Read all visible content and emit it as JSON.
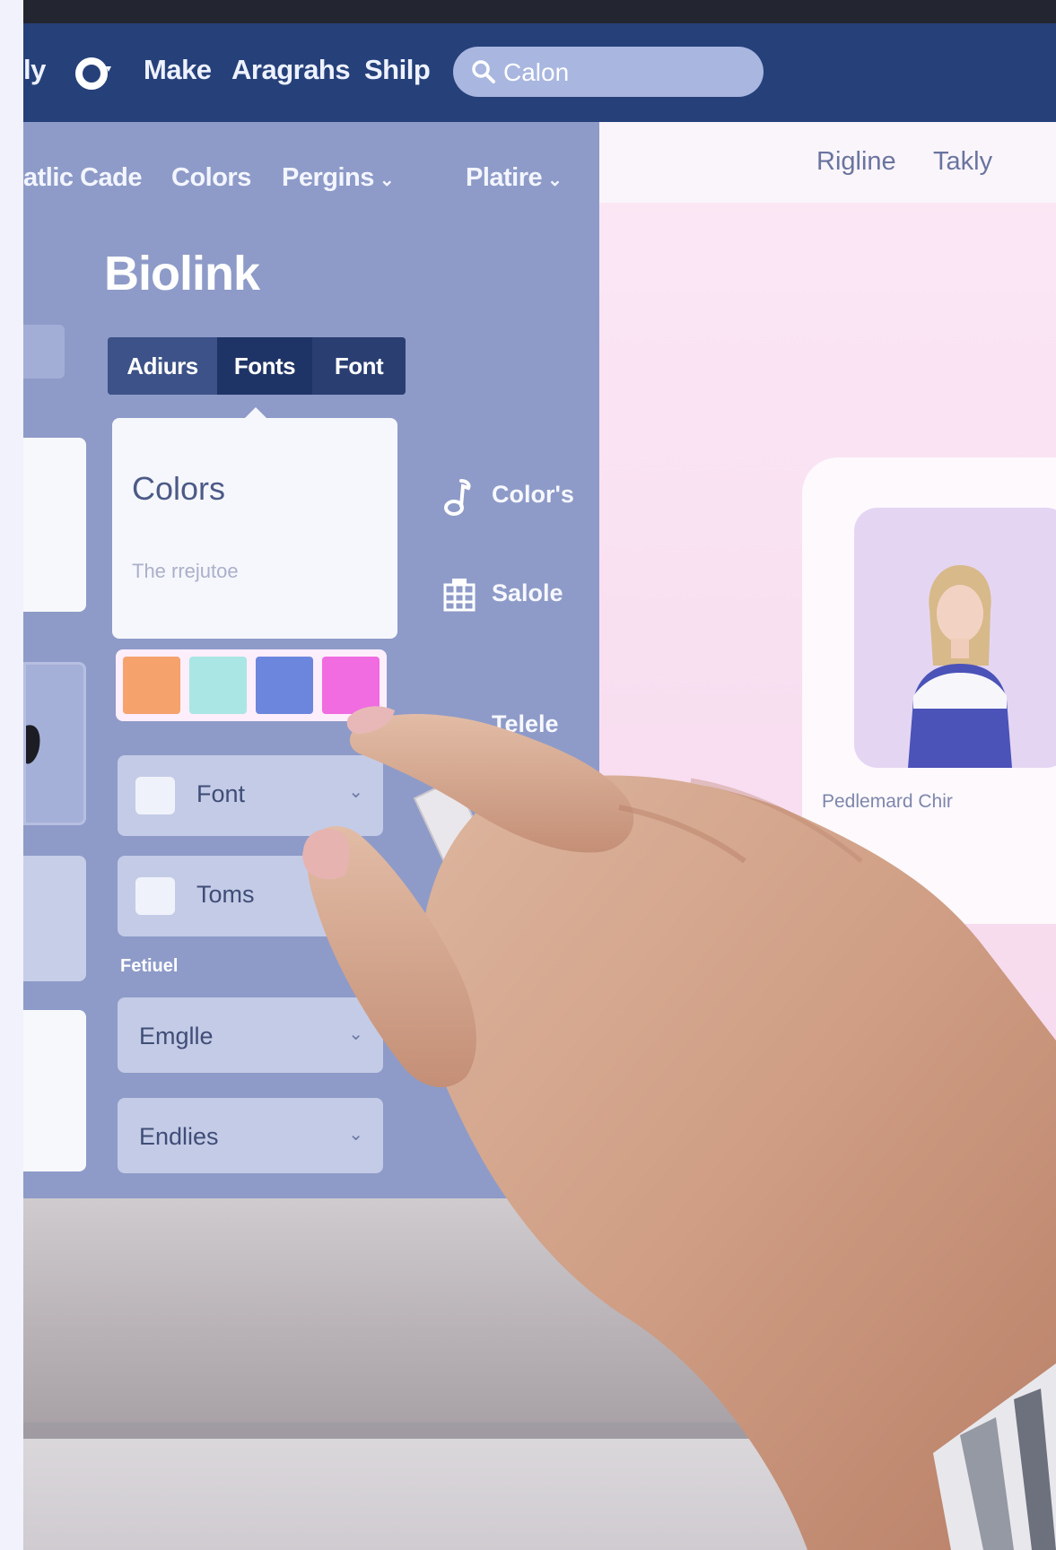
{
  "topnav": {
    "items": [
      "ly",
      "Make",
      "Aragrahs",
      "Shilp"
    ],
    "search_value": "Calon"
  },
  "subnav": {
    "items": [
      "atlic Cade",
      "Colors",
      "Pergins",
      "Platire"
    ]
  },
  "brand": "Biolink",
  "tabs": [
    "Adiurs",
    "Fonts",
    "Font"
  ],
  "colors_card": {
    "title": "Colors",
    "subtitle": "The rrejutoe"
  },
  "swatches": [
    "#f5a26c",
    "#a9e6e4",
    "#6c86dd",
    "#f06ce0"
  ],
  "fields": [
    "Font",
    "Toms"
  ],
  "section_label": "Fetiuel",
  "selects": [
    "Emglle",
    "Endlies"
  ],
  "side_actions": [
    {
      "icon": "music-note-icon",
      "label": "Color's"
    },
    {
      "icon": "grid-icon",
      "label": "Salole"
    },
    {
      "icon": "link-icon",
      "label": "Telele"
    }
  ],
  "preview": {
    "header_items": [
      "Rigline",
      "Takly"
    ],
    "profile_name": "Pedlemard Chir"
  },
  "colors": {
    "nav_bg": "#26417a",
    "panel_bg": "#8e9bc8",
    "preview_bg": "#f8def0"
  }
}
